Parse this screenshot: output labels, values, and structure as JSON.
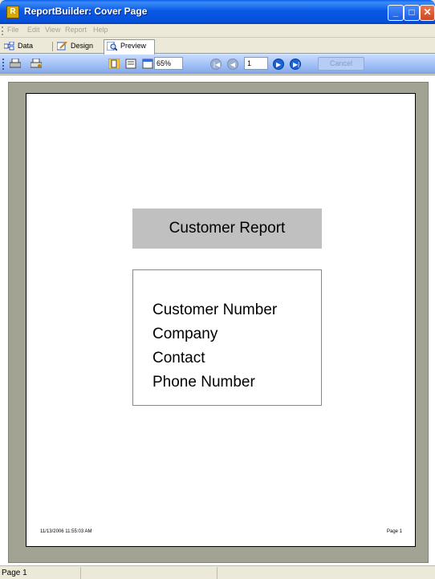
{
  "window": {
    "title": "ReportBuilder: Cover Page",
    "app_icon_letter": "R"
  },
  "menu": {
    "items": [
      "File",
      "Edit",
      "View",
      "Report",
      "Help"
    ]
  },
  "tabs": {
    "data_label": "Data",
    "design_label": "Design",
    "preview_label": "Preview",
    "active": "Preview"
  },
  "toolbar": {
    "icons": [
      "print-icon",
      "print-setup-icon",
      "whole-page-icon",
      "page-width-icon",
      "hundred-percent-icon"
    ],
    "zoom_value": "65%",
    "page_number": "1",
    "cancel_label": "Cancel"
  },
  "report": {
    "title": "Customer Report",
    "fields": [
      "Customer Number",
      "Company",
      "Contact",
      "Phone Number"
    ],
    "footer_date": "11/13/2006 11:55:03 AM",
    "footer_page": "Page 1"
  },
  "status": {
    "page_text": "Page 1"
  },
  "colors": {
    "titlebar_blue": "#0a58e6",
    "preview_bg": "#a3a394",
    "report_title_bg": "#c0c0c0"
  }
}
